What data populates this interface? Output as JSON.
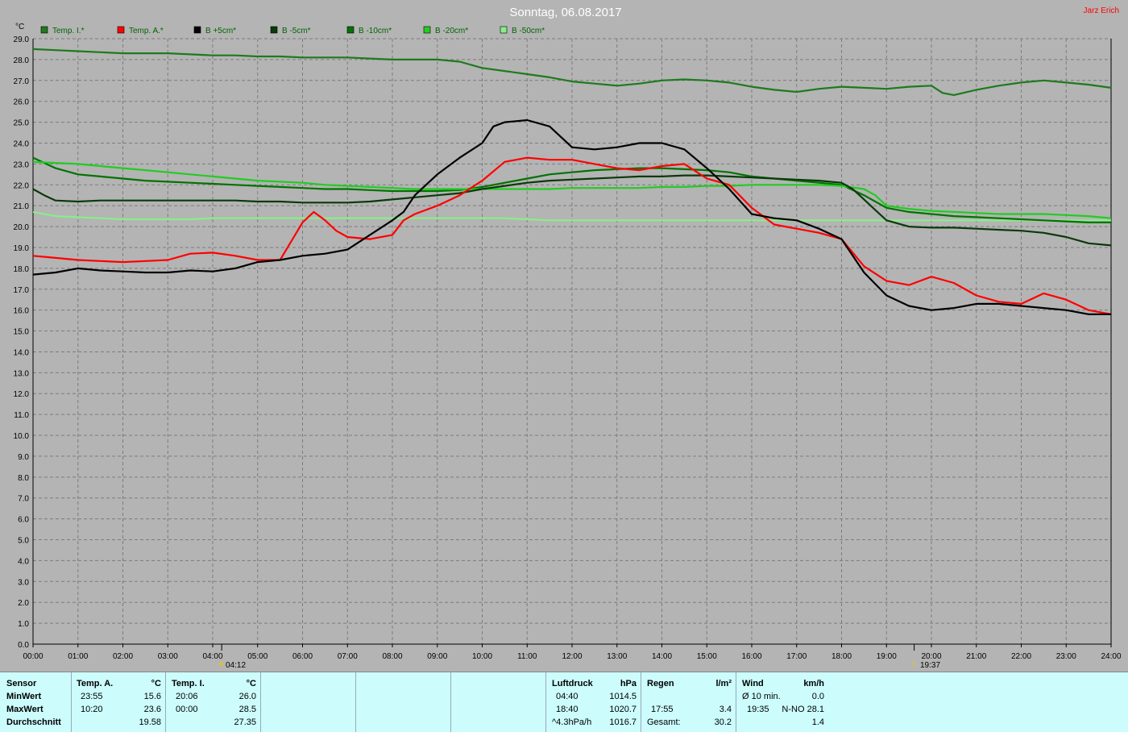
{
  "header": {
    "date": "Sonntag, 06.08.2017",
    "author": "Jarz Erich"
  },
  "colors": {
    "background": "#b4b4b4",
    "grid": "#7c7c7c",
    "axis": "#000000",
    "panel": "#ccfcfc",
    "author": "#ff0000",
    "date": "#ffffff",
    "legend_text": "#006400"
  },
  "markers": {
    "sunrise": "04:12",
    "sunset": "19:37",
    "sunrise_icon": "sun-icon",
    "sunset_icon": "moon-icon"
  },
  "chart_data": {
    "type": "line",
    "ylabel": "°C",
    "ylim": [
      0,
      29
    ],
    "y_ticks": [
      "0.0",
      "1.0",
      "2.0",
      "3.0",
      "4.0",
      "5.0",
      "6.0",
      "7.0",
      "8.0",
      "9.0",
      "10.0",
      "11.0",
      "12.0",
      "13.0",
      "14.0",
      "15.0",
      "16.0",
      "17.0",
      "18.0",
      "19.0",
      "20.0",
      "21.0",
      "22.0",
      "23.0",
      "24.0",
      "25.0",
      "26.0",
      "27.0",
      "28.0",
      "29.0"
    ],
    "xlim": [
      0,
      24
    ],
    "x_ticks": [
      "00:00",
      "01:00",
      "02:00",
      "03:00",
      "04:00",
      "05:00",
      "06:00",
      "07:00",
      "08:00",
      "09:00",
      "10:00",
      "11:00",
      "12:00",
      "13:00",
      "14:00",
      "15:00",
      "16:00",
      "17:00",
      "18:00",
      "19:00",
      "20:00",
      "21:00",
      "22:00",
      "23:00",
      "24:00"
    ],
    "grid": true,
    "legend_position": "top",
    "series": [
      {
        "name": "Temp. I.*",
        "color": "#1e7a1e",
        "x": [
          0,
          0.5,
          1,
          1.5,
          2,
          2.5,
          3,
          3.5,
          4,
          4.5,
          5,
          5.5,
          6,
          6.5,
          7,
          7.5,
          8,
          8.5,
          9,
          9.5,
          10,
          10.5,
          11,
          11.5,
          12,
          12.5,
          13,
          13.5,
          14,
          14.5,
          15,
          15.5,
          16,
          16.5,
          17,
          17.5,
          18,
          18.5,
          19,
          19.5,
          20,
          20.25,
          20.5,
          21,
          21.5,
          22,
          22.5,
          23,
          23.5,
          24
        ],
        "y": [
          28.5,
          28.45,
          28.4,
          28.35,
          28.3,
          28.3,
          28.3,
          28.25,
          28.2,
          28.2,
          28.15,
          28.15,
          28.1,
          28.1,
          28.1,
          28.05,
          28.0,
          28.0,
          28.0,
          27.9,
          27.6,
          27.45,
          27.3,
          27.15,
          26.95,
          26.85,
          26.75,
          26.85,
          27.0,
          27.05,
          27.0,
          26.9,
          26.7,
          26.55,
          26.45,
          26.6,
          26.7,
          26.65,
          26.6,
          26.7,
          26.75,
          26.4,
          26.3,
          26.55,
          26.75,
          26.9,
          27.0,
          26.9,
          26.8,
          26.65
        ]
      },
      {
        "name": "Temp. A.*",
        "color": "#ff0000",
        "x": [
          0,
          0.5,
          1,
          1.5,
          2,
          2.5,
          3,
          3.5,
          4,
          4.5,
          5,
          5.5,
          5.75,
          6,
          6.25,
          6.5,
          6.75,
          7,
          7.5,
          8,
          8.25,
          8.5,
          9,
          9.5,
          10,
          10.5,
          11,
          11.5,
          12,
          12.5,
          13,
          13.5,
          14,
          14.5,
          15,
          15.5,
          16,
          16.5,
          17,
          17.5,
          18,
          18.5,
          19,
          19.5,
          20,
          20.5,
          21,
          21.5,
          22,
          22.5,
          23,
          23.5,
          24
        ],
        "y": [
          18.6,
          18.5,
          18.4,
          18.35,
          18.3,
          18.35,
          18.4,
          18.7,
          18.75,
          18.6,
          18.4,
          18.4,
          19.3,
          20.2,
          20.7,
          20.3,
          19.8,
          19.5,
          19.4,
          19.6,
          20.3,
          20.6,
          21.0,
          21.5,
          22.2,
          23.1,
          23.3,
          23.2,
          23.2,
          23.0,
          22.8,
          22.7,
          22.9,
          23.0,
          22.3,
          22.0,
          20.9,
          20.1,
          19.9,
          19.7,
          19.4,
          18.1,
          17.4,
          17.2,
          17.6,
          17.3,
          16.7,
          16.4,
          16.3,
          16.8,
          16.5,
          16.0,
          15.8
        ]
      },
      {
        "name": "B +5cm*",
        "color": "#000000",
        "x": [
          0,
          0.5,
          1,
          1.5,
          2,
          2.5,
          3,
          3.5,
          4,
          4.5,
          5,
          5.5,
          6,
          6.5,
          7,
          7.5,
          8,
          8.25,
          8.5,
          9,
          9.5,
          10,
          10.25,
          10.5,
          11,
          11.5,
          12,
          12.5,
          13,
          13.5,
          14,
          14.5,
          15,
          15.5,
          16,
          16.5,
          17,
          17.5,
          18,
          18.5,
          19,
          19.5,
          20,
          20.5,
          21,
          21.5,
          22,
          22.5,
          23,
          23.5,
          24
        ],
        "y": [
          17.7,
          17.8,
          18.0,
          17.9,
          17.85,
          17.8,
          17.8,
          17.9,
          17.85,
          18.0,
          18.3,
          18.4,
          18.6,
          18.7,
          18.9,
          19.6,
          20.3,
          20.7,
          21.5,
          22.5,
          23.3,
          24.0,
          24.8,
          25.0,
          25.1,
          24.8,
          23.8,
          23.7,
          23.8,
          24.0,
          24.0,
          23.7,
          22.8,
          21.8,
          20.6,
          20.4,
          20.3,
          19.9,
          19.4,
          17.8,
          16.7,
          16.2,
          16.0,
          16.1,
          16.3,
          16.3,
          16.2,
          16.1,
          16.0,
          15.8,
          15.8
        ]
      },
      {
        "name": "B -5cm*",
        "color": "#0a3a0a",
        "x": [
          0,
          0.25,
          0.5,
          1,
          1.5,
          2,
          2.5,
          3,
          3.5,
          4,
          4.5,
          5,
          5.5,
          6,
          6.5,
          7,
          7.5,
          8,
          8.5,
          9,
          9.5,
          10,
          10.5,
          11,
          11.5,
          12,
          12.5,
          13,
          13.5,
          14,
          14.5,
          15,
          15.5,
          16,
          16.5,
          17,
          17.5,
          18,
          18.25,
          18.5,
          18.75,
          19,
          19.5,
          20,
          20.5,
          21,
          21.5,
          22,
          22.5,
          23,
          23.5,
          24
        ],
        "y": [
          21.8,
          21.5,
          21.25,
          21.2,
          21.25,
          21.25,
          21.25,
          21.25,
          21.25,
          21.25,
          21.25,
          21.2,
          21.2,
          21.15,
          21.15,
          21.15,
          21.2,
          21.3,
          21.4,
          21.5,
          21.6,
          21.8,
          21.95,
          22.1,
          22.2,
          22.25,
          22.3,
          22.35,
          22.4,
          22.4,
          22.45,
          22.45,
          22.4,
          22.35,
          22.3,
          22.25,
          22.2,
          22.1,
          21.8,
          21.3,
          20.8,
          20.3,
          20.0,
          19.95,
          19.95,
          19.9,
          19.85,
          19.8,
          19.7,
          19.5,
          19.2,
          19.1
        ]
      },
      {
        "name": "B -10cm*",
        "color": "#007300",
        "x": [
          0,
          0.5,
          1,
          1.5,
          2,
          2.5,
          3,
          3.5,
          4,
          4.5,
          5,
          5.5,
          6,
          6.5,
          7,
          7.5,
          8,
          8.5,
          9,
          9.5,
          10,
          10.5,
          11,
          11.5,
          12,
          12.5,
          13,
          13.5,
          14,
          14.5,
          15,
          15.5,
          16,
          16.5,
          17,
          17.5,
          18,
          18.5,
          19,
          19.5,
          20,
          20.5,
          21,
          21.5,
          22,
          22.5,
          23,
          23.5,
          24
        ],
        "y": [
          23.3,
          22.8,
          22.5,
          22.4,
          22.3,
          22.2,
          22.15,
          22.1,
          22.05,
          22.0,
          21.95,
          21.9,
          21.85,
          21.8,
          21.8,
          21.75,
          21.7,
          21.7,
          21.7,
          21.75,
          21.9,
          22.1,
          22.3,
          22.5,
          22.6,
          22.7,
          22.75,
          22.8,
          22.8,
          22.75,
          22.7,
          22.6,
          22.4,
          22.3,
          22.2,
          22.1,
          22.0,
          21.5,
          20.9,
          20.7,
          20.6,
          20.5,
          20.45,
          20.4,
          20.35,
          20.3,
          20.25,
          20.2,
          20.2
        ]
      },
      {
        "name": "B -20cm*",
        "color": "#22cc22",
        "x": [
          0,
          0.5,
          1,
          1.5,
          2,
          2.5,
          3,
          3.5,
          4,
          4.5,
          5,
          5.5,
          6,
          6.5,
          7,
          7.5,
          8,
          8.5,
          9,
          9.5,
          10,
          10.5,
          11,
          11.5,
          12,
          12.5,
          13,
          13.5,
          14,
          14.5,
          15,
          15.5,
          16,
          16.5,
          17,
          17.5,
          18,
          18.5,
          18.75,
          19,
          19.5,
          20,
          20.5,
          21,
          21.5,
          22,
          22.5,
          23,
          23.5,
          24
        ],
        "y": [
          23.1,
          23.05,
          23.0,
          22.9,
          22.8,
          22.7,
          22.6,
          22.5,
          22.4,
          22.3,
          22.2,
          22.15,
          22.1,
          22.0,
          21.95,
          21.9,
          21.85,
          21.8,
          21.8,
          21.8,
          21.8,
          21.8,
          21.8,
          21.8,
          21.85,
          21.85,
          21.85,
          21.85,
          21.9,
          21.9,
          21.95,
          21.95,
          22.0,
          22.0,
          22.0,
          22.0,
          21.95,
          21.8,
          21.5,
          21.0,
          20.85,
          20.75,
          20.7,
          20.65,
          20.6,
          20.6,
          20.6,
          20.55,
          20.5,
          20.4
        ]
      },
      {
        "name": "B -50cm*",
        "color": "#88ee88",
        "x": [
          0,
          0.5,
          1,
          1.5,
          2,
          2.5,
          3,
          3.5,
          4,
          4.5,
          5,
          5.5,
          6,
          6.5,
          7,
          7.5,
          8,
          8.5,
          9,
          9.5,
          10,
          10.5,
          11,
          11.5,
          12,
          12.5,
          13,
          13.5,
          14,
          14.5,
          15,
          15.5,
          16,
          16.5,
          17,
          17.5,
          18,
          18.5,
          19,
          19.5,
          20,
          20.5,
          21,
          21.5,
          22,
          22.5,
          23,
          23.5,
          24
        ],
        "y": [
          20.7,
          20.5,
          20.45,
          20.4,
          20.35,
          20.35,
          20.35,
          20.35,
          20.4,
          20.4,
          20.4,
          20.4,
          20.4,
          20.4,
          20.4,
          20.4,
          20.4,
          20.4,
          20.4,
          20.4,
          20.4,
          20.4,
          20.35,
          20.3,
          20.3,
          20.3,
          20.3,
          20.3,
          20.3,
          20.3,
          20.3,
          20.3,
          20.3,
          20.3,
          20.3,
          20.3,
          20.3,
          20.3,
          20.3,
          20.3,
          20.3,
          20.3,
          20.3,
          20.3,
          20.3,
          20.3,
          20.3,
          20.3,
          20.3
        ]
      }
    ]
  },
  "stats": {
    "sensor": {
      "header": "Sensor",
      "rows": [
        "MinWert",
        "MaxWert",
        "Durchschnitt"
      ]
    },
    "temp_a": {
      "header": "Temp. A.",
      "unit": "°C",
      "min_time": "23:55",
      "min": "15.6",
      "max_time": "10:20",
      "max": "23.6",
      "avg": "19.58"
    },
    "temp_i": {
      "header": "Temp. I.",
      "unit": "°C",
      "min_time": "20:06",
      "min": "26.0",
      "max_time": "00:00",
      "max": "28.5",
      "avg": "27.35"
    },
    "pressure": {
      "header": "Luftdruck",
      "unit": "hPa",
      "min_time": "04:40",
      "min": "1014.5",
      "max_time": "18:40",
      "max": "1020.7",
      "trend": "^4.3hPa/h",
      "avg": "1016.7"
    },
    "rain": {
      "header": "Regen",
      "unit": "l/m²",
      "time": "17:55",
      "value": "3.4",
      "total_label": "Gesamt:",
      "total": "30.2"
    },
    "wind": {
      "header": "Wind",
      "unit": "km/h",
      "avg_label": "Ø 10 min.",
      "avg": "0.0",
      "max_time": "19:35",
      "max": "N-NO 28.1",
      "mean": "1.4"
    }
  }
}
